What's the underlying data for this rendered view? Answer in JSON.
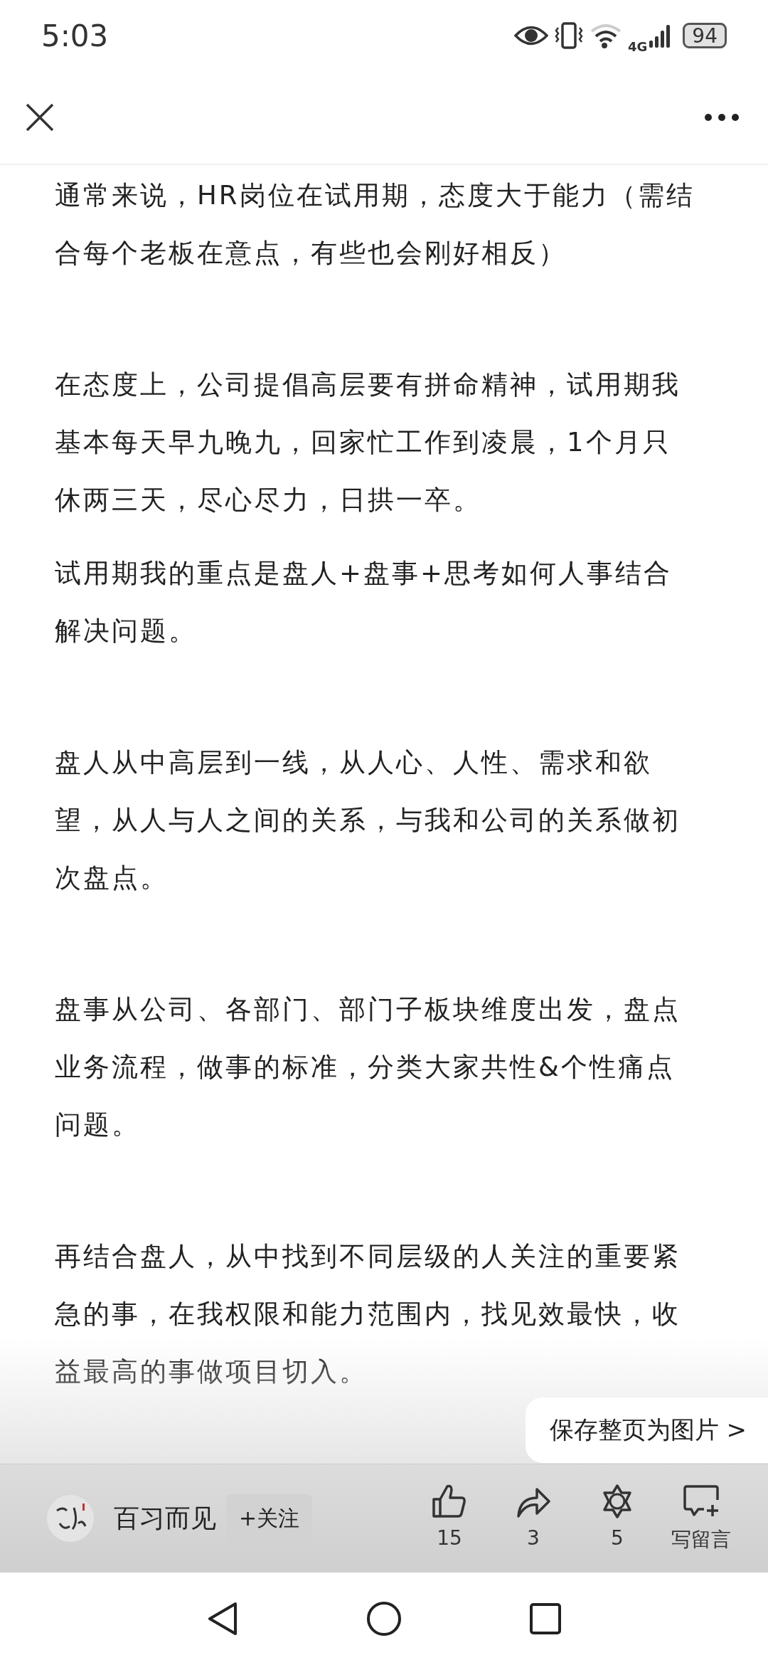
{
  "status_bar": {
    "time": "5:03",
    "battery": "94",
    "network": "4G"
  },
  "paragraphs": [
    {
      "blank_before": false,
      "lines": [
        "通常来说，HR岗位在试用期，态度大于能力（需结",
        "合每个老板在意点，有些也会刚好相反）"
      ]
    },
    {
      "blank_before": true,
      "lines": [
        "在态度上，公司提倡高层要有拼命精神，试用期我",
        "基本每天早九晚九，回家忙工作到凌晨，1个月只",
        "休两三天，尽心尽力，日拱一卒。"
      ]
    },
    {
      "blank_before": false,
      "lines": [
        "试用期我的重点是盘人+盘事+思考如何人事结合",
        "解决问题。"
      ]
    },
    {
      "blank_before": true,
      "lines": [
        "盘人从中高层到一线，从人心、人性、需求和欲",
        "望，从人与人之间的关系，与我和公司的关系做初",
        "次盘点。"
      ]
    },
    {
      "blank_before": true,
      "lines": [
        "盘事从公司、各部门、部门子板块维度出发，盘点",
        "业务流程，做事的标准，分类大家共性&个性痛点",
        "问题。"
      ]
    },
    {
      "blank_before": true,
      "lines": [
        "再结合盘人，从中找到不同层级的人关注的重要紧",
        "急的事，在我权限和能力范围内，找见效最快，收",
        "益最高的事做项目切入。"
      ]
    }
  ],
  "save_popup": "保存整页为图片 >",
  "bottom_bar": {
    "author": "百习而见",
    "follow": "+关注",
    "actions": [
      {
        "kind": "like",
        "label": "15"
      },
      {
        "kind": "share",
        "label": "3"
      },
      {
        "kind": "star",
        "label": "5"
      },
      {
        "kind": "comment",
        "label": "写留言"
      }
    ]
  }
}
